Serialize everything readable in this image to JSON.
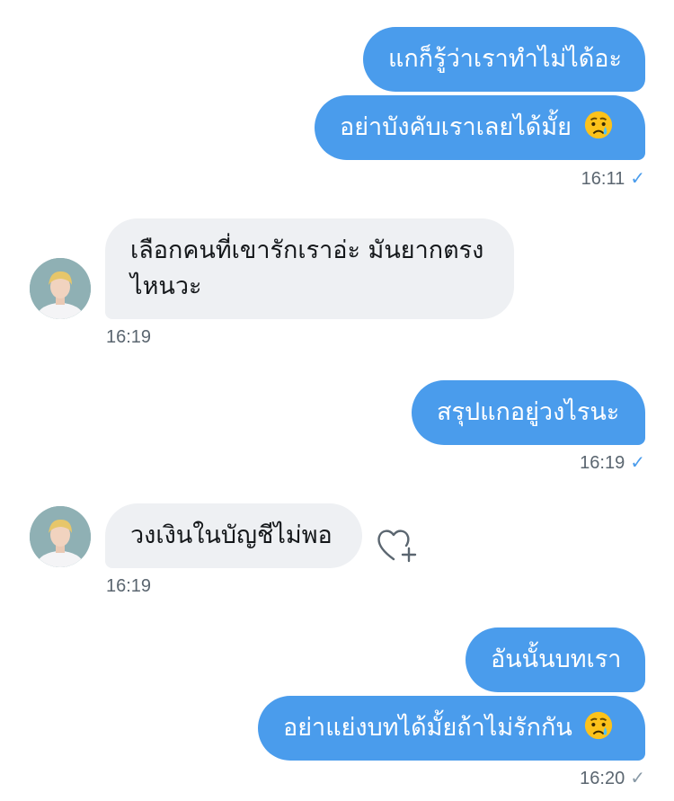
{
  "messages": [
    {
      "dir": "out",
      "text": "แกก็รู้ว่าเราทำไม่ได้อะ"
    },
    {
      "dir": "out",
      "text": "อย่าบังคับเราเลยได้มั้ย",
      "emoji": "crying-face"
    },
    {
      "dir": "out",
      "time": "16:11",
      "status": "read"
    },
    {
      "dir": "in",
      "lines": [
        "เลือกคนที่เขารักเราอ่ะ มันยากตรง",
        "ไหนวะ"
      ],
      "time": "16:19"
    },
    {
      "dir": "out",
      "text": "สรุปแกอยู่วงไรนะ",
      "time": "16:19",
      "status": "read"
    },
    {
      "dir": "in",
      "text": "วงเงินในบัญชีไม่พอ",
      "time": "16:19"
    },
    {
      "dir": "out",
      "text": "อันนั้นบทเรา"
    },
    {
      "dir": "out",
      "text": "อย่าแย่งบทได้มั้ยถ้าไม่รักกัน",
      "emoji": "crying-face",
      "time": "16:20",
      "status": "sent"
    }
  ],
  "icons": {
    "read": "check-icon",
    "like": "heart-plus-icon",
    "emoji": "crying-face-emoji"
  },
  "colors": {
    "outgoing": "#4a9cec",
    "incoming": "#eef0f3",
    "timestamp": "#5b6670"
  }
}
